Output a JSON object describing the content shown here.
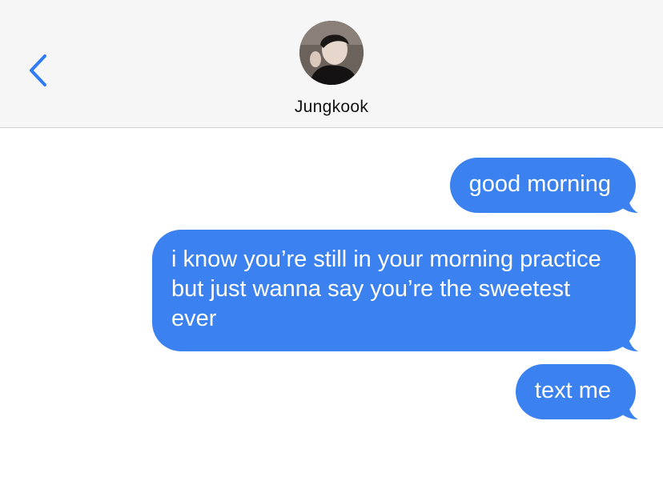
{
  "header": {
    "back_icon": "chevron-left-icon",
    "contact_name": "Jungkook",
    "avatar": "contact-avatar"
  },
  "messages": [
    {
      "direction": "outgoing",
      "text": "good morning"
    },
    {
      "direction": "outgoing",
      "text": "i know you’re still in your morning practice but just wanna say you’re the sweetest ever"
    },
    {
      "direction": "outgoing",
      "text": "text me"
    }
  ],
  "colors": {
    "header_bg": "#f6f6f6",
    "bubble_blue": "#3b82f0",
    "accent_blue": "#2f7cf6",
    "bubble_text": "#ffffff"
  }
}
